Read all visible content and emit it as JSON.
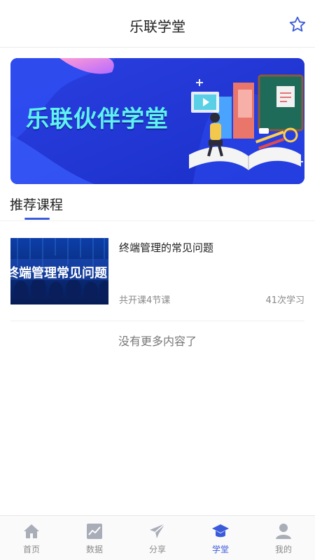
{
  "header": {
    "title": "乐联学堂",
    "favorite_icon": "star-outline-icon"
  },
  "banner": {
    "text": "乐联伙伴学堂"
  },
  "section": {
    "title": "推荐课程"
  },
  "courses": [
    {
      "title": "终端管理的常见问题",
      "thumbnail_text": "终端管理常见问题",
      "lessons": "共开课4节课",
      "views": "41次学习"
    }
  ],
  "list_end": "没有更多内容了",
  "tabs": [
    {
      "label": "首页",
      "icon": "home-icon",
      "active": false
    },
    {
      "label": "数据",
      "icon": "chart-icon",
      "active": false
    },
    {
      "label": "分享",
      "icon": "paper-plane-icon",
      "active": false
    },
    {
      "label": "学堂",
      "icon": "graduation-cap-icon",
      "active": true
    },
    {
      "label": "我的",
      "icon": "user-icon",
      "active": false
    }
  ],
  "colors": {
    "accent": "#3b5bdb",
    "inactive": "#a8adb8",
    "banner_bg": "#2238d8",
    "banner_text": "#5ff2f0"
  }
}
